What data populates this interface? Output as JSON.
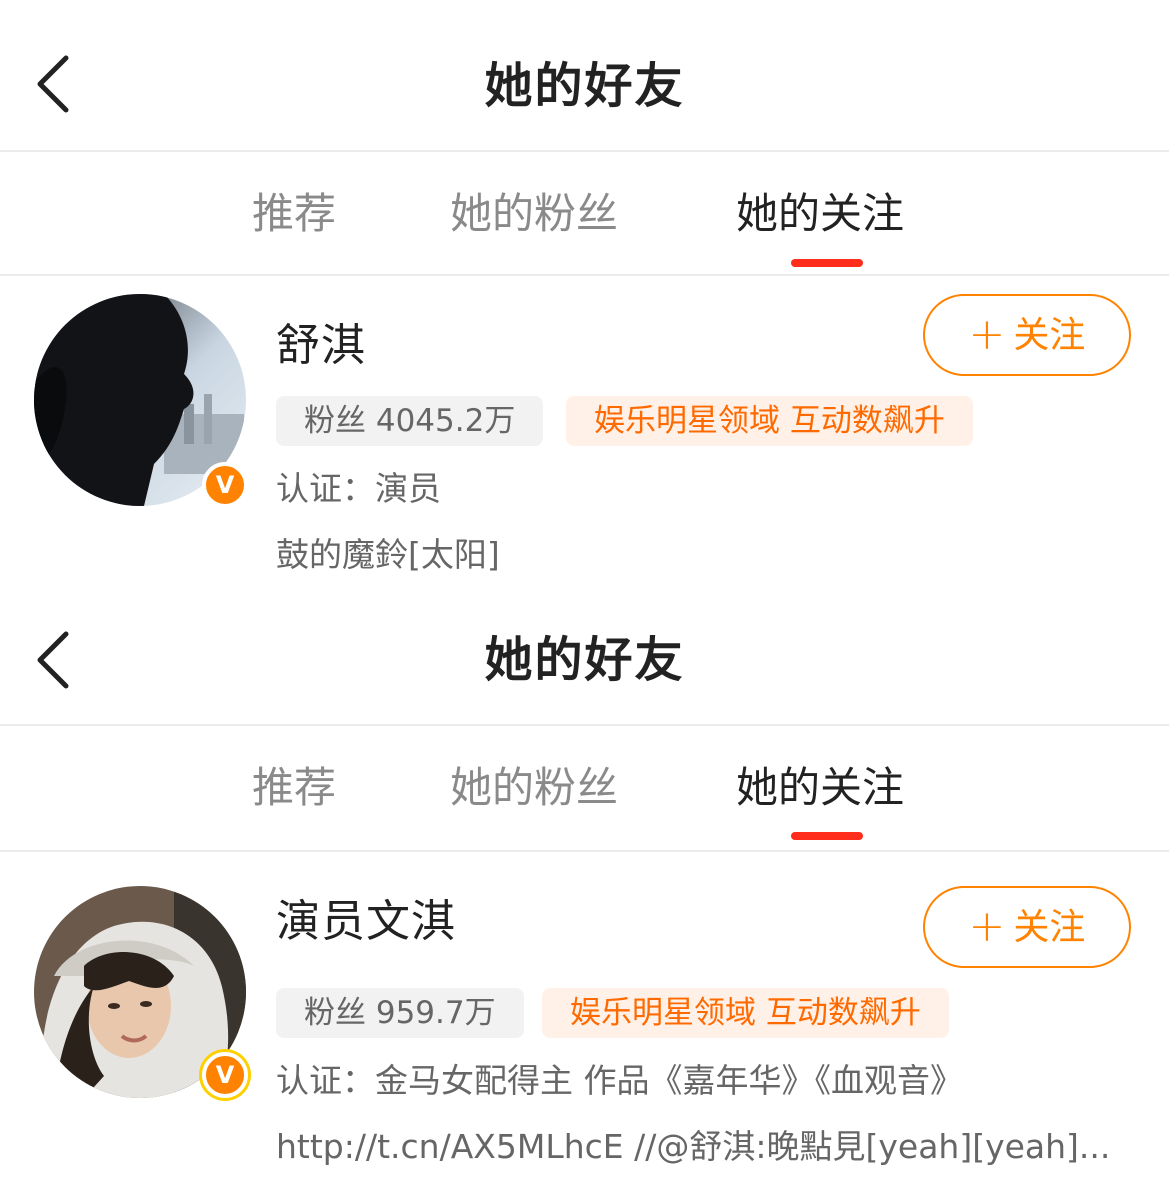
{
  "screens": [
    {
      "header": {
        "title": "她的好友"
      },
      "tabs": [
        {
          "label": "推荐"
        },
        {
          "label": "她的粉丝"
        },
        {
          "label": "她的关注"
        }
      ],
      "active_tab": "她的关注",
      "user": {
        "name": "舒淇",
        "follow_label": "关注",
        "fans_text": "粉丝 4045.2万",
        "domain_text": "娱乐明星领域 互动数飙升",
        "verified_text": "认证：演员",
        "bio": "鼓的魔鈴[太阳]",
        "badge": "V"
      }
    },
    {
      "header": {
        "title": "她的好友"
      },
      "tabs": [
        {
          "label": "推荐"
        },
        {
          "label": "她的粉丝"
        },
        {
          "label": "她的关注"
        }
      ],
      "active_tab": "她的关注",
      "user": {
        "name": "演员文淇",
        "follow_label": "关注",
        "fans_text": "粉丝 959.7万",
        "domain_text": "娱乐明星领域 互动数飙升",
        "verified_text": "认证：金马女配得主 作品《嘉年华》《血观音》",
        "bio": "http://t.cn/AX5MLhcE //@舒淇:晚點見[yeah][yeah]...",
        "badge": "V"
      }
    }
  ],
  "colors": {
    "accent": "#ff8200",
    "tab_underline": "#ff2d1c",
    "domain_text": "#ff6a00",
    "domain_bg": "#fff1e8",
    "chip_bg": "#f2f2f2"
  },
  "icons": [
    "back-chevron-icon",
    "plus-icon",
    "verified-v-icon"
  ]
}
